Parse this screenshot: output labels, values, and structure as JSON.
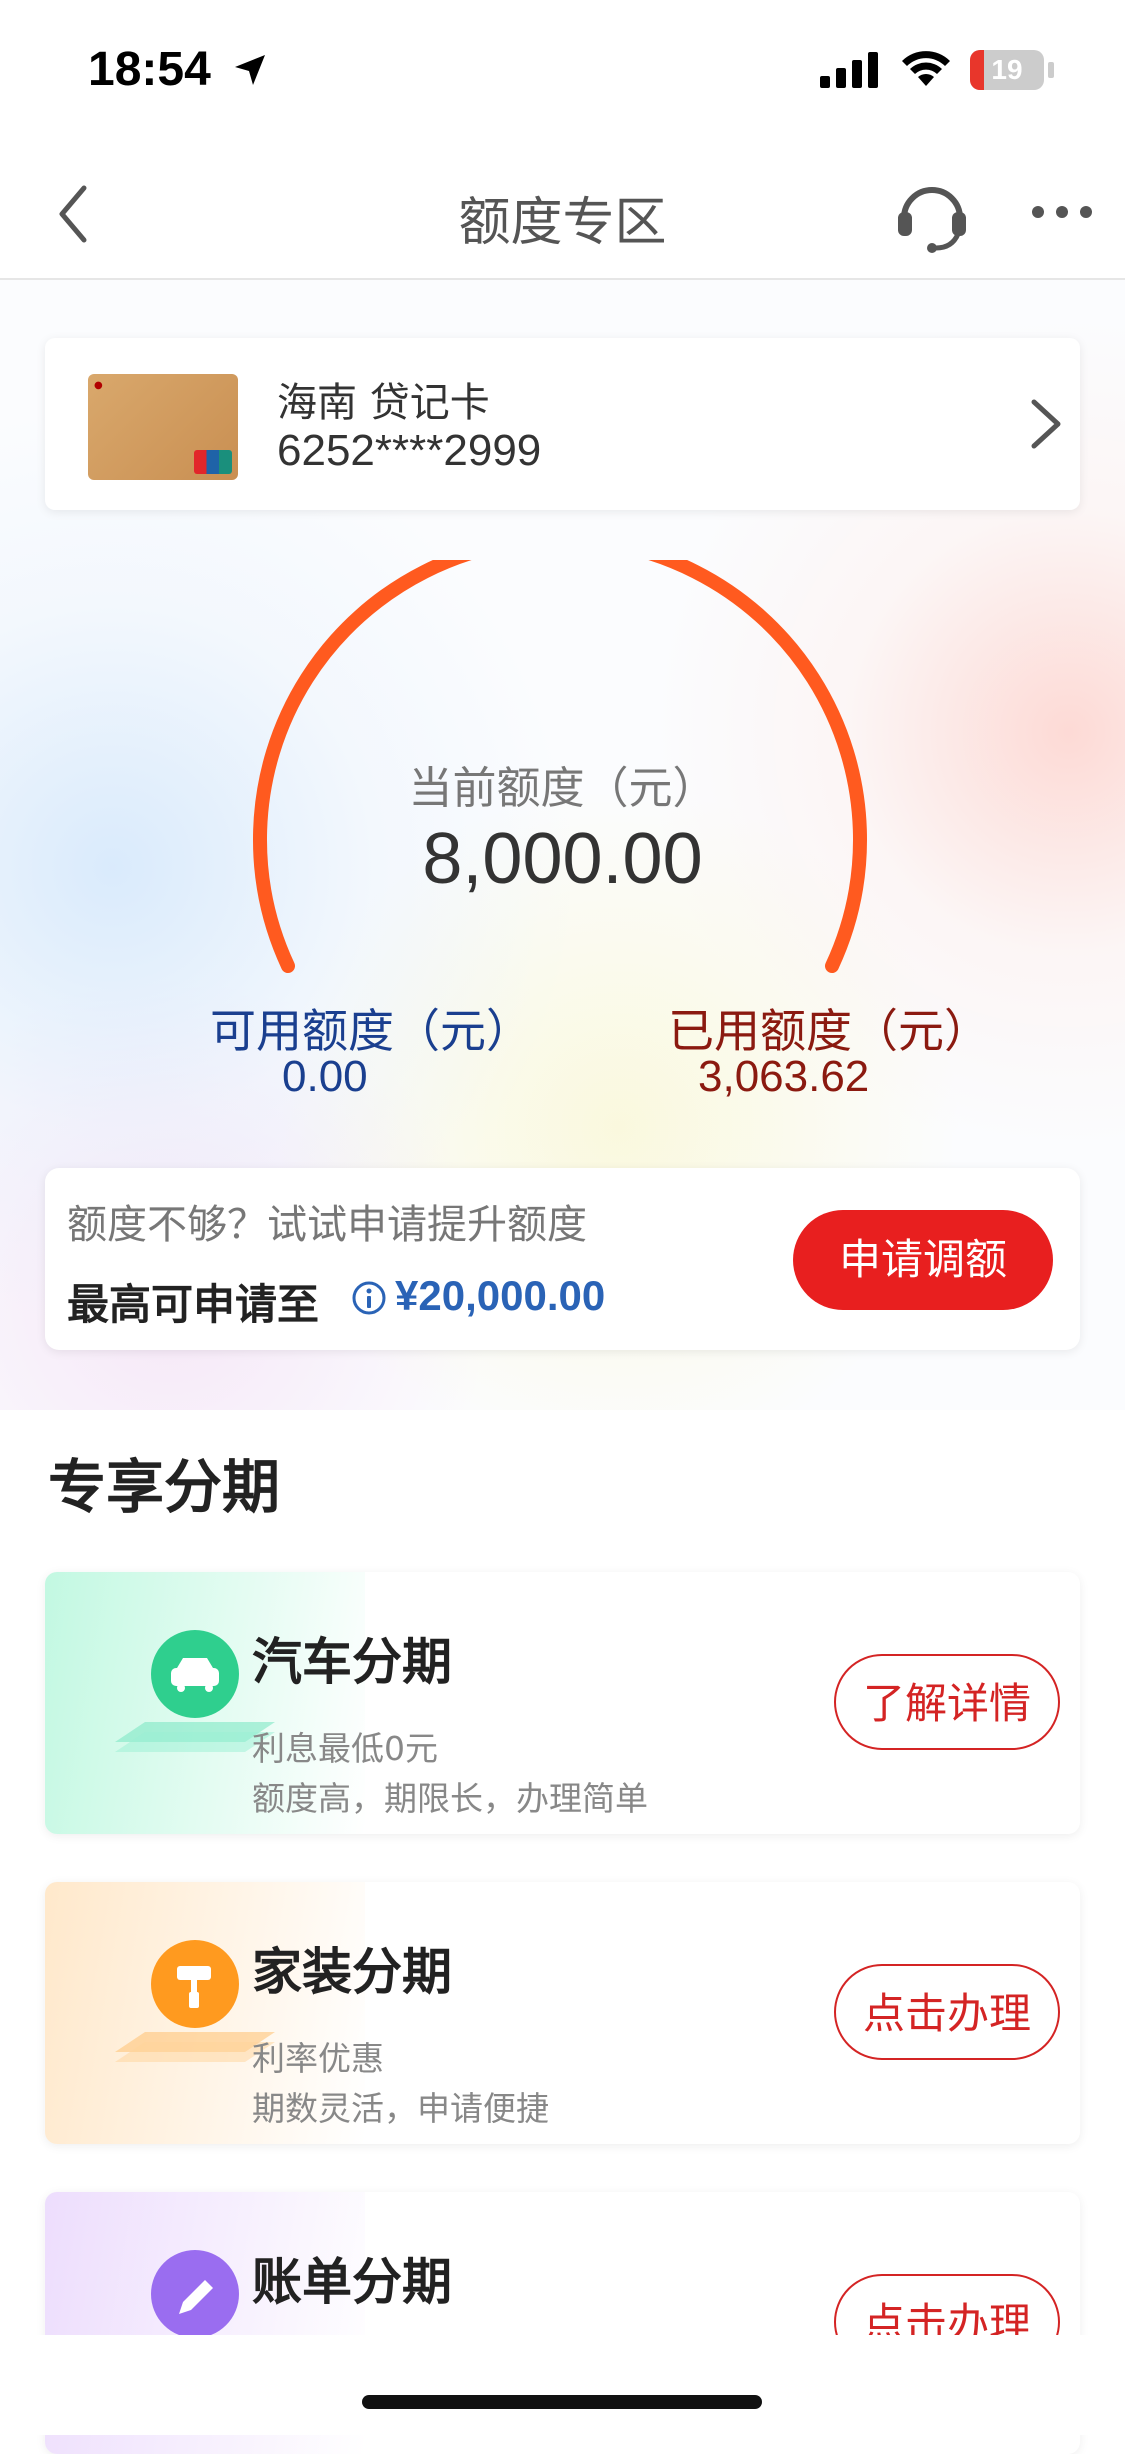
{
  "status_bar": {
    "time": "18:54",
    "battery": "19",
    "battery_level": 0.19
  },
  "nav": {
    "title": "额度专区"
  },
  "card": {
    "name": "海南 贷记卡",
    "number": "6252****2999"
  },
  "gauge": {
    "label": "当前额度（元）",
    "value": "8,000.00",
    "available_label": "可用额度（元）",
    "available_value": "0.00",
    "used_label": "已用额度（元）",
    "used_value": "3,063.62",
    "arc_color": "#ff5a1f"
  },
  "raise": {
    "question": "额度不够？试试申请提升额度",
    "max_label": "最高可申请至",
    "max_value": "¥20,000.00",
    "button": "申请调额"
  },
  "section": {
    "title": "专享分期"
  },
  "products": [
    {
      "name": "汽车分期",
      "desc1": "利息最低0元",
      "desc2": "额度高，期限长，办理简单",
      "button": "了解详情",
      "icon": "car-icon",
      "color": "#2fcf8e"
    },
    {
      "name": "家装分期",
      "desc1": "利率优惠",
      "desc2": "期数灵活，申请便捷",
      "button": "点击办理",
      "icon": "paint-roller-icon",
      "color": "#ff9a1f"
    },
    {
      "name": "账单分期",
      "desc1": "",
      "desc2": "",
      "button": "点击办理",
      "icon": "pen-icon",
      "color": "#9a6df0"
    }
  ],
  "colors": {
    "accent_red": "#e81f1f",
    "blue": "#2a63b6",
    "dark_blue": "#1a3f8f",
    "dark_red": "#8b1a10"
  }
}
